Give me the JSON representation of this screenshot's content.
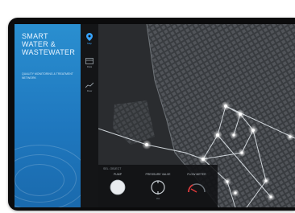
{
  "app": {
    "title_lines": [
      "Smart",
      "Water &",
      "Wastewater"
    ],
    "subtitle": "Quality monitoring & treatment network"
  },
  "nav": {
    "items": [
      {
        "label": "Map",
        "icon": "map-pin-icon",
        "active": true
      },
      {
        "label": "Data",
        "icon": "layers-icon",
        "active": false
      },
      {
        "label": "Flow",
        "icon": "chart-icon",
        "active": false
      }
    ]
  },
  "panel": {
    "title": "Sel. Object",
    "controls": [
      {
        "label": "Pump",
        "value": "",
        "icon": "pump-knob-icon"
      },
      {
        "label": "Pressure Valve",
        "value": "0%",
        "icon": "valve-icon"
      },
      {
        "label": "Flow Meter",
        "value": "",
        "icon": "gauge-icon"
      }
    ]
  },
  "colors": {
    "brand": "#2a8fd0",
    "accent": "#37a4ff",
    "node": "#ffffff",
    "alert": "#e0393b"
  }
}
